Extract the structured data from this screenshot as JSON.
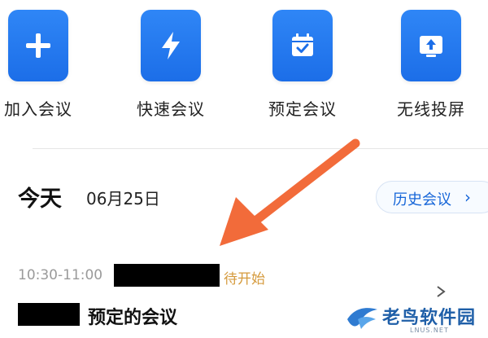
{
  "actions": [
    {
      "label": "加入会议",
      "icon": "plus-icon"
    },
    {
      "label": "快速会议",
      "icon": "lightning-icon"
    },
    {
      "label": "预定会议",
      "icon": "calendar-check-icon"
    },
    {
      "label": "无线投屏",
      "icon": "screen-cast-icon"
    }
  ],
  "today": {
    "title": "今天",
    "date": "06月25日",
    "history_button": "历史会议",
    "history_chevron": "›"
  },
  "meeting": {
    "time": "10:30-11:00",
    "status": "待开始",
    "title": "预定的会议"
  },
  "watermark": {
    "text": "老鸟软件园",
    "sub": "LNUS.NET"
  },
  "colors": {
    "accent_blue": "#1c6ee8",
    "status_orange": "#d59a3c",
    "annotation_arrow": "#f26b3a",
    "link_blue": "#1565d8"
  }
}
